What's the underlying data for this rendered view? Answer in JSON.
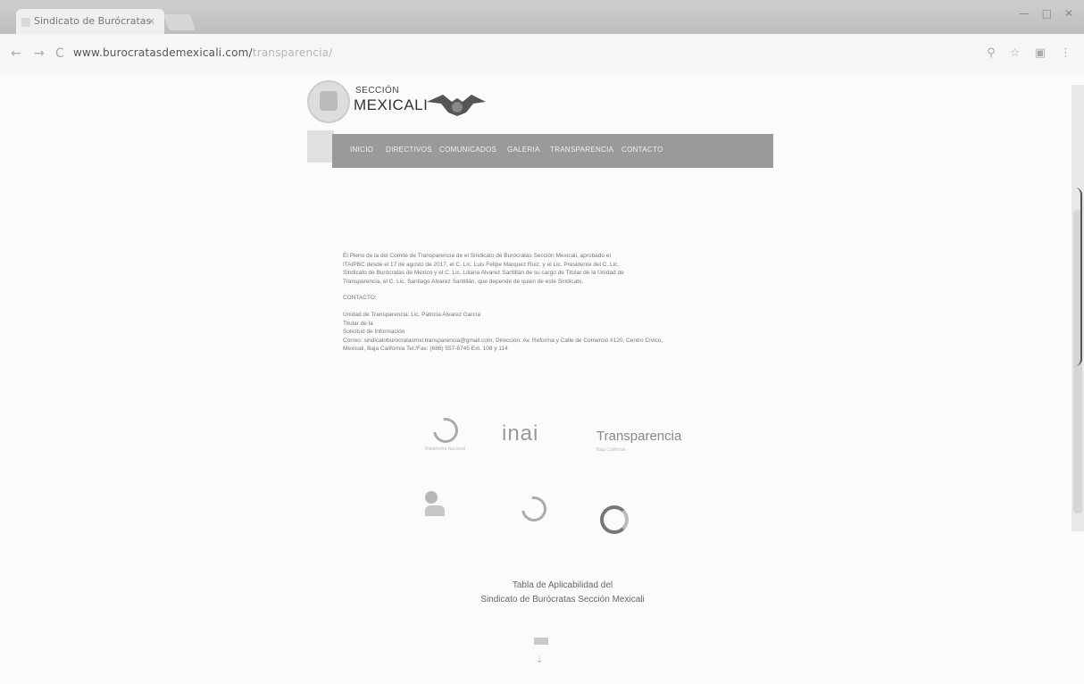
{
  "browser": {
    "tab_title": "Sindicato de Burócratas",
    "tab_close": "×",
    "url_host": "www.burocratasdemexicali.com/",
    "url_path": "transparencia/",
    "window_controls": [
      "—",
      "□",
      "✕"
    ],
    "toolbar_icons": [
      "search-icon",
      "star-icon",
      "extension-icon",
      "menu-icon"
    ]
  },
  "site": {
    "logo_small": "SECCIÓN",
    "logo_big": "MEXICALI"
  },
  "nav": {
    "items": [
      "INICIO",
      "DIRECTIVOS",
      "COMUNICADOS",
      "GALERIA",
      "TRANSPARENCIA",
      "CONTACTO"
    ]
  },
  "content": {
    "paragraph_lines": [
      "El Pleno de la del Comité de Transparencia de el Sindicato de Burócratas Sección Mexicali, aprobado el",
      "ITAIPBC desde el 17 de agosto de 2017, el C. Lic. Luis Felipe Marquez Ruiz, y el Lic. Presidente del C. Lic.",
      "Sindicato de Burócratas de México y el C. Lic. Liliana Alvarez Santillán de su cargo de Titular de la Unidad de",
      "Transparencia, el C. Lic. Santiago Alvarez Santillán, que depende de quien de este Sindicato."
    ],
    "contact_heading": "CONTACTO:",
    "contact_lines": [
      "Unidad de Transparencia: Lic. Patricia Alvarez García",
      "Titular de la",
      "Solicitud de Información",
      "Correo: sindicatoburocratasmxl.transparencia@gmail.com, Dirección: Av. Reforma y Calle de Comercio #120, Centro Cívico,",
      "Mexicali, Baja California Tel./Fax: (686) 557-8745 Ext. 108 y 114"
    ]
  },
  "logos": {
    "plataforma": "Plataforma Nacional",
    "inai": "inai",
    "transparencia": "Transparencia",
    "transparencia_sub": "Baja California"
  },
  "footer": {
    "line1": "Tabla de Aplicabilidad del",
    "line2": "Sindicato de Burócratas Sección Mexicali"
  }
}
